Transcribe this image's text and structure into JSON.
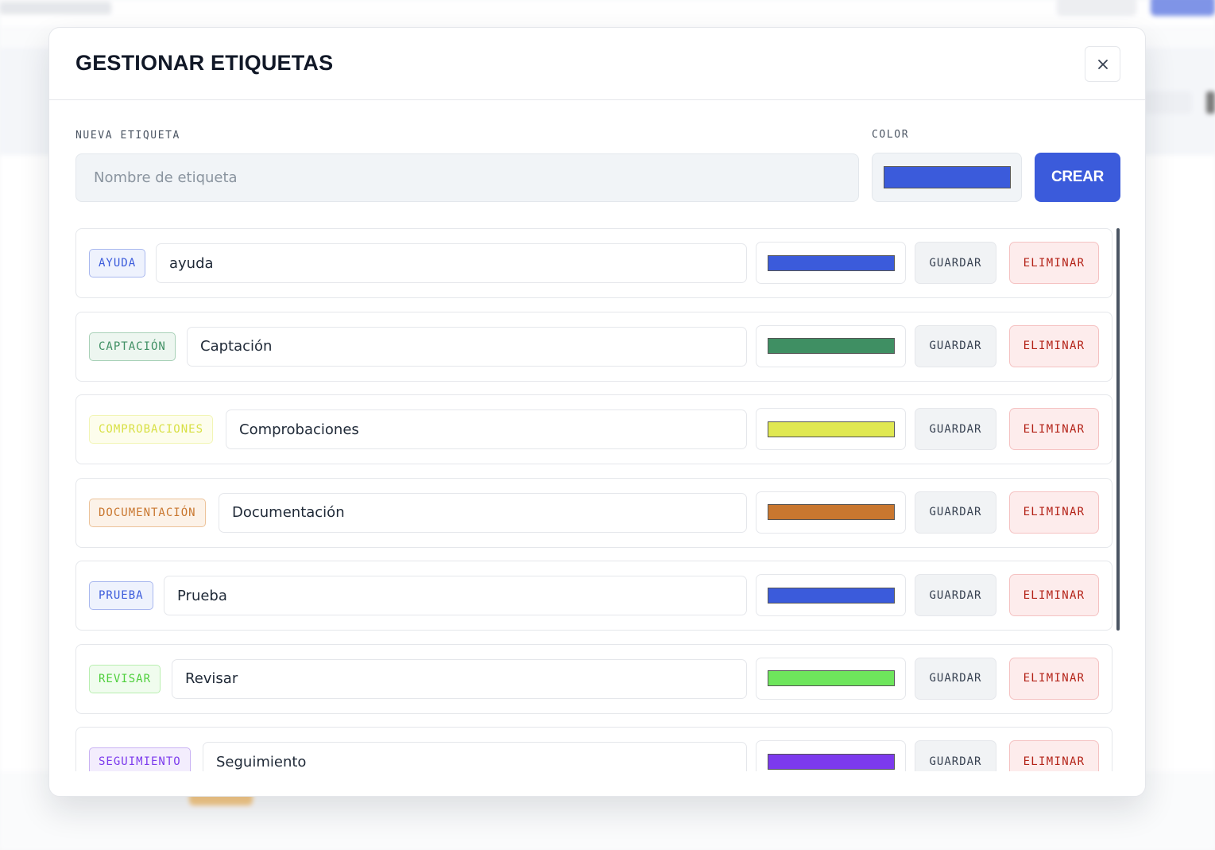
{
  "background": {
    "accent": "#3b5bdb"
  },
  "modal": {
    "title": "GESTIONAR ETIQUETAS",
    "close_icon": "close-icon"
  },
  "form": {
    "name_label": "NUEVA ETIQUETA",
    "name_placeholder": "Nombre de etiqueta",
    "name_value": "",
    "color_label": "COLOR",
    "color_value": "#3b5bdb",
    "create_label": "CREAR"
  },
  "tags": [
    {
      "badge": "AYUDA",
      "name": "ayuda",
      "color": "#3b5bdb",
      "badge_bg": "#eef2fd",
      "badge_border": "#a9b8ef",
      "badge_text": "#3b5bdb",
      "save": "GUARDAR",
      "delete": "ELIMINAR"
    },
    {
      "badge": "CAPTACIÓN",
      "name": "Captación",
      "color": "#3f8f63",
      "badge_bg": "#edf6f0",
      "badge_border": "#a9d1b8",
      "badge_text": "#3f8f63",
      "save": "GUARDAR",
      "delete": "ELIMINAR"
    },
    {
      "badge": "COMPROBACIONES",
      "name": "Comprobaciones",
      "color": "#e0e852",
      "badge_bg": "#fdfdec",
      "badge_border": "#f2f5b5",
      "badge_text": "#d8e045",
      "save": "GUARDAR",
      "delete": "ELIMINAR"
    },
    {
      "badge": "DOCUMENTACIÓN",
      "name": "Documentación",
      "color": "#c9772f",
      "badge_bg": "#fcf2e8",
      "badge_border": "#ecc39a",
      "badge_text": "#c9772f",
      "save": "GUARDAR",
      "delete": "ELIMINAR"
    },
    {
      "badge": "PRUEBA",
      "name": "Prueba",
      "color": "#3b5bdb",
      "badge_bg": "#eef2fd",
      "badge_border": "#a9b8ef",
      "badge_text": "#3b5bdb",
      "save": "GUARDAR",
      "delete": "ELIMINAR"
    },
    {
      "badge": "REVISAR",
      "name": "Revisar",
      "color": "#6ee65c",
      "badge_bg": "#f0fcee",
      "badge_border": "#b9efb0",
      "badge_text": "#4fcf3d",
      "save": "GUARDAR",
      "delete": "ELIMINAR"
    },
    {
      "badge": "SEGUIMIENTO",
      "name": "Seguimiento",
      "color": "#7c3aed",
      "badge_bg": "#f3edfd",
      "badge_border": "#c9b2f3",
      "badge_text": "#7c3aed",
      "save": "GUARDAR",
      "delete": "ELIMINAR"
    }
  ]
}
